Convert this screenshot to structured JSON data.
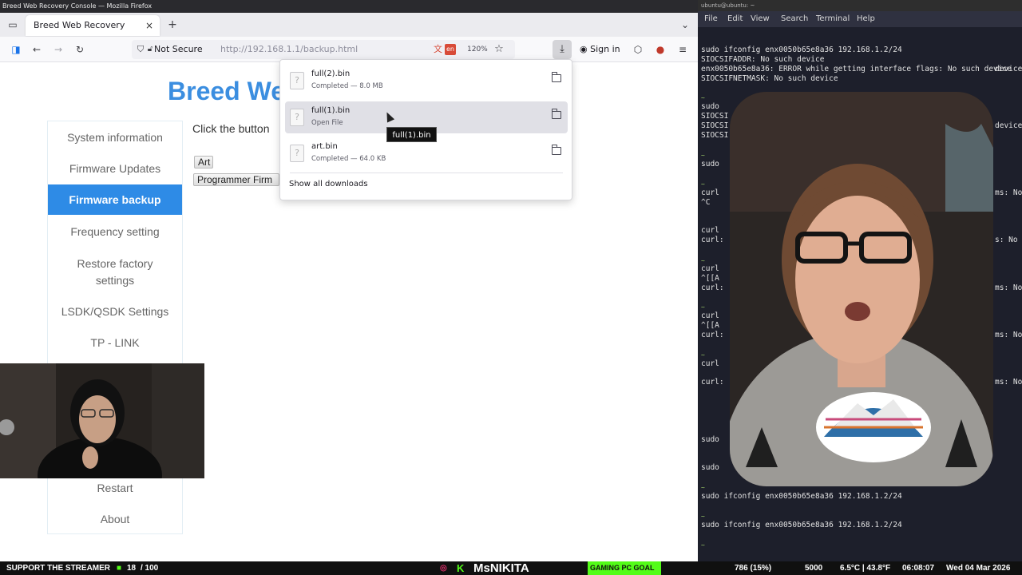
{
  "firefox": {
    "window_title": "Breed Web Recovery Console — Mozilla Firefox",
    "tab_title": "Breed Web Recovery Console",
    "tab_close": "×",
    "new_tab": "+",
    "not_secure": "Not Secure",
    "url": "http://192.168.1.1/backup.html",
    "translate_lang": "en",
    "zoom": "120%",
    "sign_in": "Sign in"
  },
  "page": {
    "heading": "Breed We",
    "instruction": "Click the button",
    "buttons": {
      "art": "Art",
      "programmer": "Programmer Firm"
    },
    "sidebar": [
      {
        "label": "System information"
      },
      {
        "label": "Firmware Updates"
      },
      {
        "label": "Firmware backup"
      },
      {
        "label": "Frequency setting"
      },
      {
        "label": "Restore factory settings"
      },
      {
        "label": "LSDK/QSDK Settings"
      },
      {
        "label": "TP - LINK"
      },
      {
        "label": "Restart"
      },
      {
        "label": "About"
      }
    ]
  },
  "downloads": {
    "items": [
      {
        "name": "full(2).bin",
        "status": "Completed — 8.0 MB"
      },
      {
        "name": "full(1).bin",
        "status": "Open File"
      },
      {
        "name": "art.bin",
        "status": "Completed — 64.0 KB"
      }
    ],
    "show_all": "Show all downloads",
    "tooltip": "full(1).bin"
  },
  "terminal": {
    "title": "ubuntu@ubuntu: ~",
    "menu": [
      "File",
      "Edit",
      "View",
      "Search",
      "Terminal",
      "Help"
    ],
    "lines": [
      "sudo ifconfig enx0050b65e8a36 192.168.1.2/24",
      "SIOCSIFADDR: No such device",
      "enx0050b65e8a36: ERROR while getting interface flags: No such device",
      "SIOCSIFNETMASK: No such device",
      "sudo",
      "SIOCSI",
      "SIOCSI",
      "SIOCSI",
      "sudo",
      "curl",
      "^C",
      "curl",
      "curl:",
      "curl",
      "^[[A",
      "curl:",
      "curl",
      "^[[A",
      "curl:",
      "curl",
      "curl:",
      "sudo",
      "sudo",
      "sudo ifconfig enx0050b65e8a36 192.168.1.2/24",
      "sudo ifconfig enx0050b65e8a36 192.168.1.2/24"
    ],
    "right_fragments": [
      "device",
      "device",
      "s: No",
      "ms: No",
      "ms: No",
      "ms: No",
      "ms: No"
    ]
  },
  "stream": {
    "support": "SUPPORT THE STREAMER",
    "count": "18",
    "goal_total": "/ 100",
    "channel": "MsNIKITA",
    "pc_goal": "GAMING PC GOAL",
    "pc_progress": "786 (15%)",
    "goal_target": "5000",
    "weather": "6.5°C | 43.8°F",
    "time": "06:08:07",
    "date": "Wed 04 Mar 2026"
  }
}
